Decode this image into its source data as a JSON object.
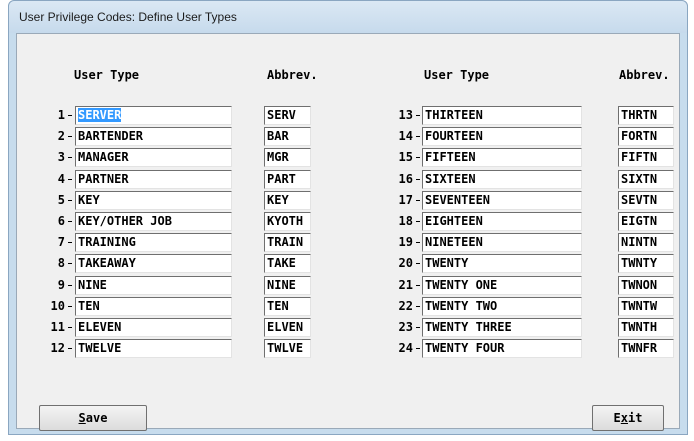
{
  "window": {
    "title": "User Privilege Codes: Define User Types"
  },
  "headers": {
    "user_type": "User Type",
    "abbrev": "Abbrev."
  },
  "rows": [
    {
      "num": "1",
      "type": "SERVER",
      "abbr": "SERV",
      "selected": true
    },
    {
      "num": "2",
      "type": "BARTENDER",
      "abbr": "BAR"
    },
    {
      "num": "3",
      "type": "MANAGER",
      "abbr": "MGR"
    },
    {
      "num": "4",
      "type": "PARTNER",
      "abbr": "PART"
    },
    {
      "num": "5",
      "type": "KEY",
      "abbr": "KEY"
    },
    {
      "num": "6",
      "type": "KEY/OTHER JOB",
      "abbr": "KYOTH"
    },
    {
      "num": "7",
      "type": "TRAINING",
      "abbr": "TRAIN"
    },
    {
      "num": "8",
      "type": "TAKEAWAY",
      "abbr": "TAKE"
    },
    {
      "num": "9",
      "type": "NINE",
      "abbr": "NINE"
    },
    {
      "num": "10",
      "type": "TEN",
      "abbr": "TEN"
    },
    {
      "num": "11",
      "type": "ELEVEN",
      "abbr": "ELVEN"
    },
    {
      "num": "12",
      "type": "TWELVE",
      "abbr": "TWLVE"
    },
    {
      "num": "13",
      "type": "THIRTEEN",
      "abbr": "THRTN"
    },
    {
      "num": "14",
      "type": "FOURTEEN",
      "abbr": "FORTN"
    },
    {
      "num": "15",
      "type": "FIFTEEN",
      "abbr": "FIFTN"
    },
    {
      "num": "16",
      "type": "SIXTEEN",
      "abbr": "SIXTN"
    },
    {
      "num": "17",
      "type": "SEVENTEEN",
      "abbr": "SEVTN"
    },
    {
      "num": "18",
      "type": "EIGHTEEN",
      "abbr": "EIGTN"
    },
    {
      "num": "19",
      "type": "NINETEEN",
      "abbr": "NINTN"
    },
    {
      "num": "20",
      "type": "TWENTY",
      "abbr": "TWNTY"
    },
    {
      "num": "21",
      "type": "TWENTY ONE",
      "abbr": "TWNON"
    },
    {
      "num": "22",
      "type": "TWENTY TWO",
      "abbr": "TWNTW"
    },
    {
      "num": "23",
      "type": "TWENTY THREE",
      "abbr": "TWNTH"
    },
    {
      "num": "24",
      "type": "TWENTY FOUR",
      "abbr": "TWNFR"
    }
  ],
  "buttons": {
    "save": {
      "mnemonic": "S",
      "rest": "ave"
    },
    "exit": {
      "pre": "E",
      "mnemonic": "x",
      "rest": "it"
    }
  },
  "colors": {
    "selection": "#3399ff",
    "window_frame": "#c7dced",
    "client_bg": "#f0f0f0"
  }
}
